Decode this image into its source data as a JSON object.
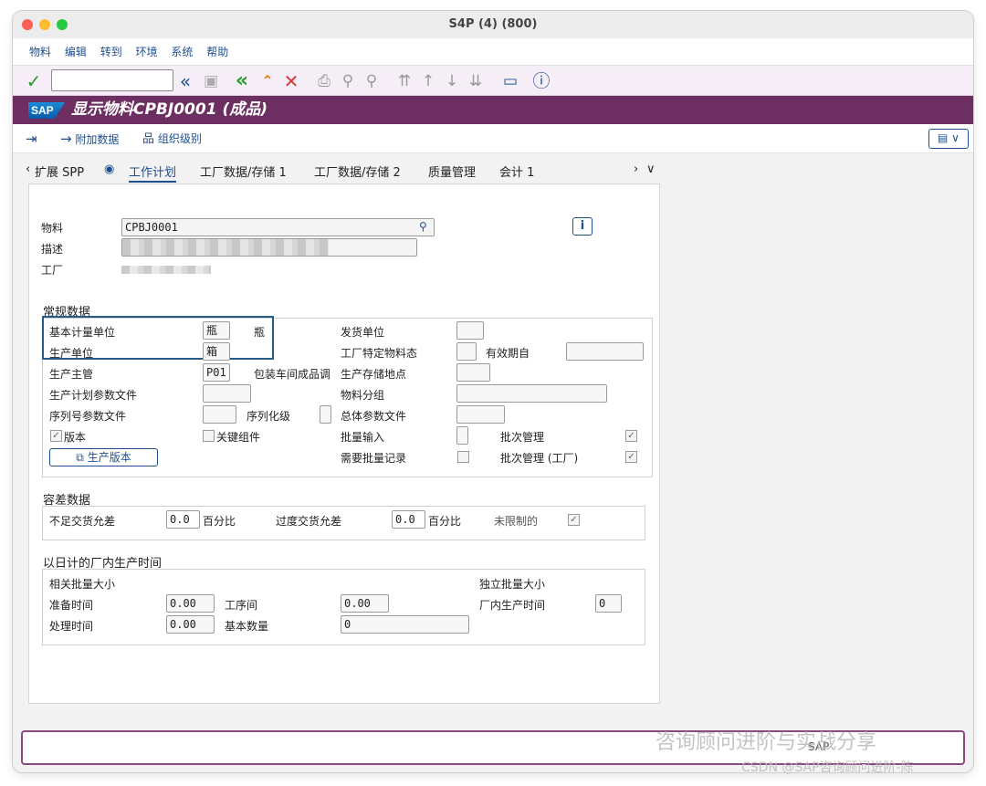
{
  "window": {
    "title": "S4P (4) (800)"
  },
  "menu": [
    "物料",
    "编辑",
    "转到",
    "环境",
    "系统",
    "帮助"
  ],
  "header": {
    "logo": "SAP",
    "title": "显示物料CPBJ0001 (成品)"
  },
  "app_toolbar": {
    "additional_data": "附加数据",
    "org_levels": "组织级别"
  },
  "tabs": {
    "prev": "‹",
    "extend_spp": "扩展 SPP",
    "work_plan": "工作计划",
    "plant_data_1": "工厂数据/存储 1",
    "plant_data_2": "工厂数据/存储 2",
    "quality": "质量管理",
    "accounting": "会计 1",
    "next": "›",
    "more": "∨"
  },
  "header_fields": {
    "material_label": "物料",
    "material_value": "CPBJ0001",
    "description_label": "描述",
    "plant_label": "工厂"
  },
  "general": {
    "title": "常规数据",
    "base_uom_label": "基本计量单位",
    "base_uom_value": "瓶",
    "base_uom_text": "瓶",
    "prod_unit_label": "生产单位",
    "prod_unit_value": "箱",
    "prod_supervisor_label": "生产主管",
    "prod_supervisor_value": "P01",
    "prod_supervisor_text": "包装车间成品调",
    "prod_sched_profile_label": "生产计划参数文件",
    "serial_profile_label": "序列号参数文件",
    "serialization_label": "序列化级",
    "version_label": "版本",
    "critical_component_label": "关键组件",
    "prod_version_button": "生产版本",
    "issue_unit_label": "发货单位",
    "plant_status_label": "工厂特定物料态",
    "valid_from_label": "有效期自",
    "storage_loc_label": "生产存储地点",
    "material_group_label": "物料分组",
    "overall_profile_label": "总体参数文件",
    "batch_entry_label": "批量输入",
    "batch_mgmt_label": "批次管理",
    "batch_record_label": "需要批量记录",
    "batch_mgmt_plant_label": "批次管理 (工厂)"
  },
  "tolerance": {
    "title": "容差数据",
    "under_label": "不足交货允差",
    "under_value": "0.0",
    "under_unit": "百分比",
    "over_label": "过度交货允差",
    "over_value": "0.0",
    "over_unit": "百分比",
    "unlimited_label": "未限制的"
  },
  "inhouse": {
    "title": "以日计的厂内生产时间",
    "lot_dependent_label": "相关批量大小",
    "lot_independent_label": "独立批量大小",
    "setup_label": "准备时间",
    "setup_value": "0.00",
    "interop_label": "工序间",
    "interop_value": "0.00",
    "inhouse_label": "厂内生产时间",
    "inhouse_value": "0",
    "processing_label": "处理时间",
    "processing_value": "0.00",
    "base_qty_label": "基本数量",
    "base_qty_value": "0"
  },
  "status": {
    "sap_label": "SAP",
    "watermark_1": "咨询顾问进阶与实战分享",
    "watermark_2": "CSDN @SAP咨询顾问进阶-陈"
  },
  "colors": {
    "header_bg": "#6d2e61",
    "accent": "#1d4f91"
  },
  "icons": [
    "check-icon",
    "back-icon",
    "save-icon",
    "back-green-icon",
    "exit-icon",
    "cancel-icon",
    "print-icon",
    "find-icon",
    "find-next-icon",
    "first-page-icon",
    "prev-page-icon",
    "next-page-icon",
    "last-page-icon",
    "layout-icon",
    "help-icon"
  ]
}
